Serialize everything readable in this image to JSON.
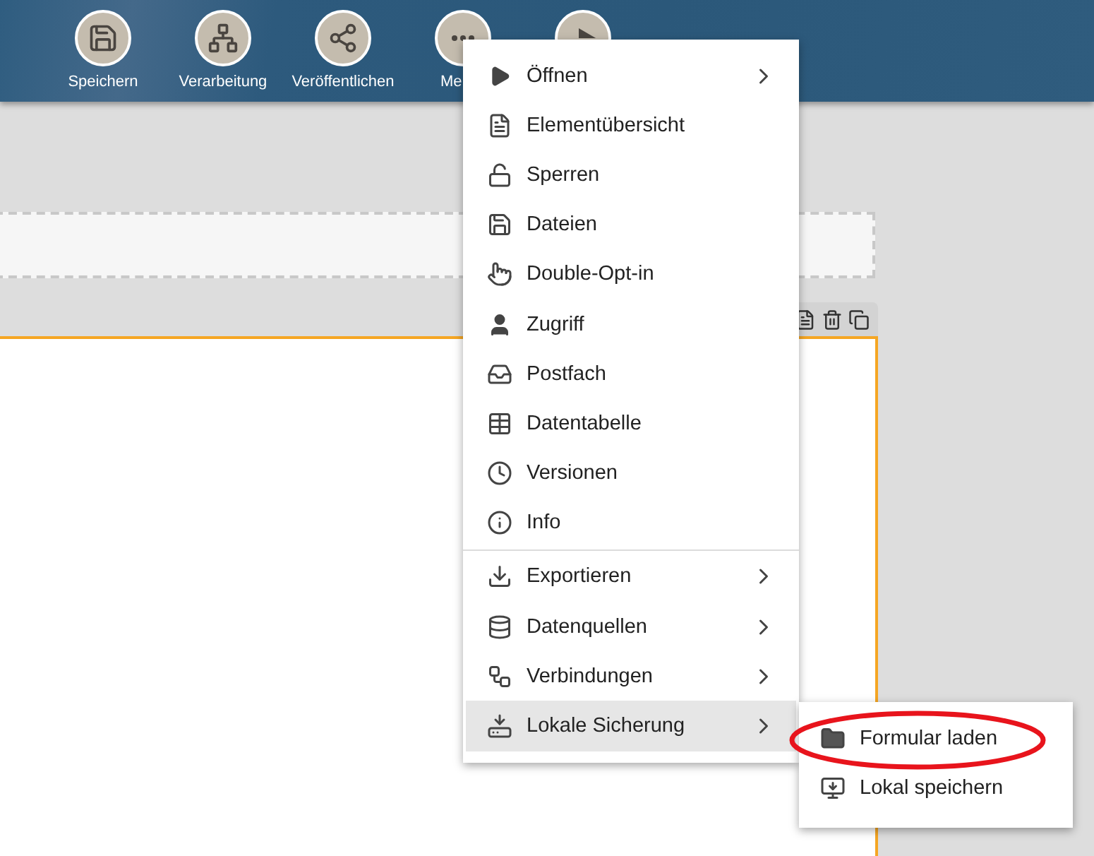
{
  "toolbar": {
    "buttons": [
      {
        "kind": "save",
        "label": "Speichern",
        "cut_off": false
      },
      {
        "kind": "sitemap",
        "label": "Verarbeitung",
        "cut_off": false
      },
      {
        "kind": "share",
        "label": "Veröffentlichen",
        "cut_off": false
      },
      {
        "kind": "more",
        "label": "Me",
        "cut_off": true
      },
      {
        "kind": "play"
      }
    ]
  },
  "menu": {
    "sections": [
      [
        {
          "label": "Öffnen",
          "has_submenu": true,
          "selected": false
        },
        {
          "label": "Elementübersicht",
          "has_submenu": false,
          "selected": false
        },
        {
          "label": "Sperren",
          "has_submenu": false,
          "selected": false
        },
        {
          "label": "Dateien",
          "has_submenu": false,
          "selected": false
        },
        {
          "label": "Double-Opt-in",
          "has_submenu": false,
          "selected": false
        },
        {
          "label": "Zugriff",
          "has_submenu": false,
          "selected": false
        },
        {
          "label": "Postfach",
          "has_submenu": false,
          "selected": false
        },
        {
          "label": "Datentabelle",
          "has_submenu": false,
          "selected": false
        },
        {
          "label": "Versionen",
          "has_submenu": false,
          "selected": false
        },
        {
          "label": "Info",
          "has_submenu": false,
          "selected": false
        }
      ],
      [
        {
          "label": "Exportieren",
          "has_submenu": true,
          "selected": false
        },
        {
          "label": "Datenquellen",
          "has_submenu": true,
          "selected": false
        },
        {
          "label": "Verbindungen",
          "has_submenu": true,
          "selected": false
        },
        {
          "label": "Lokale Sicherung",
          "has_submenu": true,
          "selected": true
        }
      ]
    ]
  },
  "submenu": {
    "items": [
      {
        "label": "Formular laden",
        "highlighted_by_annotation": true
      },
      {
        "label": "Lokal speichern",
        "highlighted_by_annotation": false
      }
    ]
  }
}
